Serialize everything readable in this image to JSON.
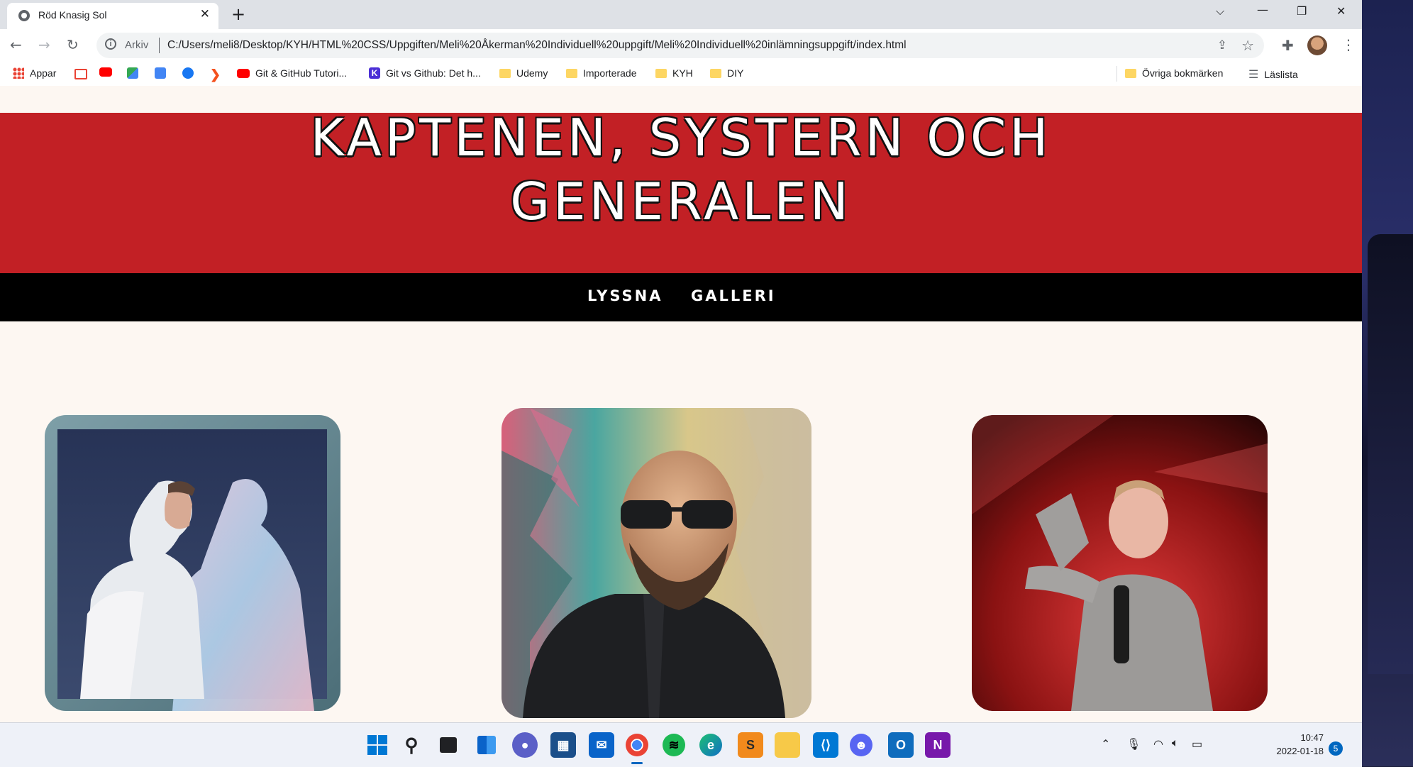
{
  "browser": {
    "tab_title": "Röd Knasig Sol",
    "address_prefix": "Arkiv",
    "url": "C:/Users/meli8/Desktop/KYH/HTML%20CSS/Uppgiften/Meli%20Åkerman%20Individuell%20uppgift/Meli%20Individuell%20inlämningsuppgift/index.html",
    "bookmarks": [
      {
        "label": "Appar",
        "icon": "apps-grid-icon"
      },
      {
        "label": "",
        "icon": "gmail-icon"
      },
      {
        "label": "",
        "icon": "youtube-icon"
      },
      {
        "label": "",
        "icon": "maps-icon"
      },
      {
        "label": "",
        "icon": "translate-icon"
      },
      {
        "label": "",
        "icon": "facebook-icon"
      },
      {
        "label": "",
        "icon": "arrow-icon"
      },
      {
        "label": "Git & GitHub Tutori...",
        "icon": "youtube-icon"
      },
      {
        "label": "Git vs Github: Det h...",
        "icon": "k-icon"
      },
      {
        "label": "Udemy",
        "icon": "folder-icon"
      },
      {
        "label": "Importerade",
        "icon": "folder-icon"
      },
      {
        "label": "KYH",
        "icon": "folder-icon"
      },
      {
        "label": "DIY",
        "icon": "folder-icon"
      }
    ],
    "other_bookmarks": "Övriga bokmärken",
    "reading_list": "Läslista"
  },
  "page": {
    "title_line1": "KAPTENEN, SYSTERN OCH",
    "title_line2": "GENERALEN",
    "nav": [
      {
        "label": "LYSSNA"
      },
      {
        "label": "GALLERI"
      }
    ],
    "colors": {
      "banner": "#c22025",
      "nav": "#000000",
      "background": "#fdf7f2"
    }
  },
  "taskbar": {
    "time": "10:47",
    "date": "2022-01-18",
    "notifications": "5"
  }
}
